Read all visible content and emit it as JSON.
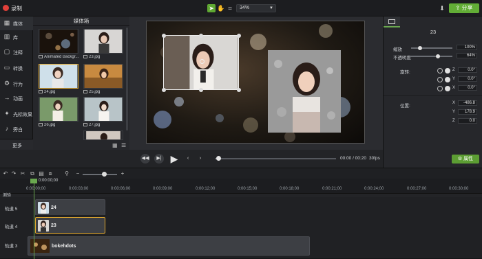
{
  "app": {
    "record_label": "录制",
    "zoom_value": "34%",
    "share_label": "分享"
  },
  "nav": {
    "items": [
      {
        "label": "媒体",
        "icon": "film-icon"
      },
      {
        "label": "库",
        "icon": "library-icon"
      },
      {
        "label": "注释",
        "icon": "annotation-icon"
      },
      {
        "label": "转换",
        "icon": "transition-icon"
      },
      {
        "label": "行为",
        "icon": "behavior-icon"
      },
      {
        "label": "动画",
        "icon": "animation-icon"
      },
      {
        "label": "光标效果",
        "icon": "cursor-icon"
      },
      {
        "label": "旁白",
        "icon": "microphone-icon"
      }
    ],
    "more_label": "更多"
  },
  "media": {
    "title": "媒体箱",
    "items": [
      {
        "caption": "Animated Backgr..."
      },
      {
        "caption": "23.jpg"
      },
      {
        "caption": "24.jpg"
      },
      {
        "caption": "25.jpg"
      },
      {
        "caption": "26.jpg"
      },
      {
        "caption": "27.jpg"
      }
    ]
  },
  "player": {
    "time": "00:00 / 00:20",
    "fps": "30fps",
    "progress": 0.0
  },
  "properties": {
    "name": "23",
    "scale_label": "缩放",
    "scale_value": "100%",
    "opacity_label": "不透明度",
    "opacity_value": "64%",
    "rotation_label": "旋转:",
    "rotation": {
      "z": "0.0°",
      "y": "0.0°",
      "x": "0.0°"
    },
    "position_label": "位置:",
    "position": {
      "x": "-486.8",
      "y": "178.9",
      "z": "0.0"
    },
    "axis_labels": {
      "x": "X",
      "y": "Y",
      "z": "Z"
    },
    "button_label": "属性"
  },
  "timeline": {
    "playhead_time": "0:00:00;00",
    "ticks": [
      "0:00:00;00",
      "0:00:03;00",
      "0:00:06;00",
      "0:00:09;00",
      "0:00:12;00",
      "0:00:15;00",
      "0:00:18;00",
      "0:00:21;00",
      "0:00:24;00",
      "0:00:27;00",
      "0:00:30;00"
    ],
    "header_label": "测验",
    "tracks": [
      {
        "label": "轨道 5",
        "clip": "24"
      },
      {
        "label": "轨道 4",
        "clip": "23"
      },
      {
        "label": "轨道 3",
        "clip": "bokehdots"
      }
    ]
  },
  "colors": {
    "accent": "#62ad36",
    "selection": "#e0a82e",
    "record": "#e2403a"
  }
}
